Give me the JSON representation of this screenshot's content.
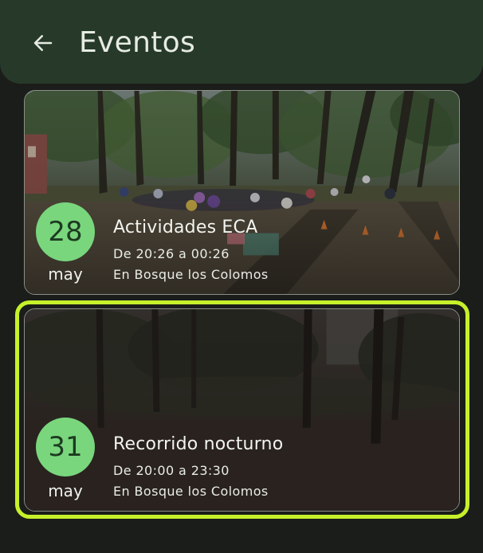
{
  "header": {
    "title": "Eventos",
    "back_icon": "arrow-left-icon"
  },
  "colors": {
    "appbar": "#273a2a",
    "background": "#1b1d1a",
    "badge": "#79d67d",
    "highlight": "#c6f12a"
  },
  "events": [
    {
      "day": "28",
      "month": "may",
      "title": "Actividades ECA",
      "time": "De 20:26 a 00:26",
      "place": "En Bosque los Colomos",
      "selected": false
    },
    {
      "day": "31",
      "month": "may",
      "title": "Recorrido nocturno",
      "time": "De 20:00 a 23:30",
      "place": "En Bosque los Colomos",
      "selected": true
    }
  ]
}
